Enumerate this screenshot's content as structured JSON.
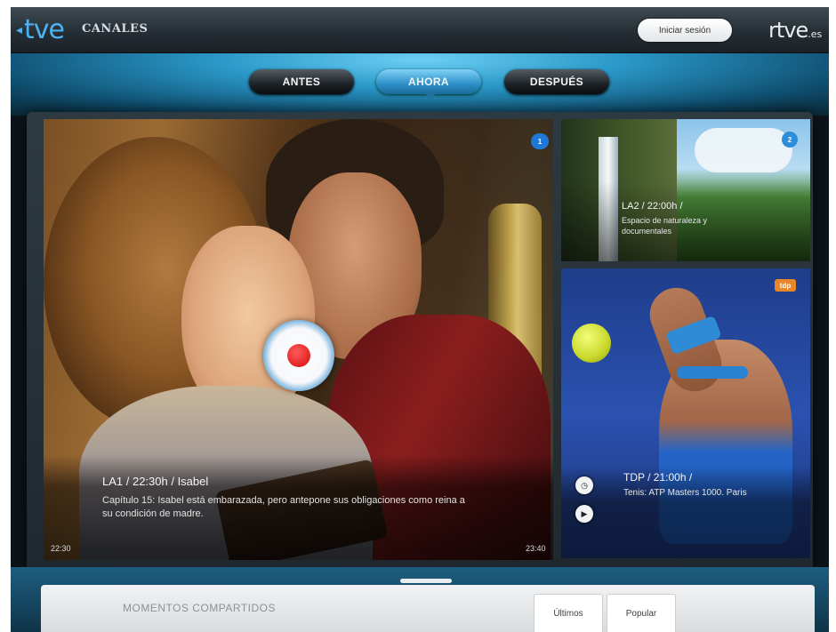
{
  "header": {
    "logo_text": "tve",
    "section_title": "CANALES",
    "login_label": "Iniciar sesión",
    "brand": "rtve",
    "brand_suffix": ".es"
  },
  "schedule_tabs": [
    {
      "label": "ANTES",
      "active": false
    },
    {
      "label": "AHORA",
      "active": true
    },
    {
      "label": "DESPUÉS",
      "active": false
    }
  ],
  "main_program": {
    "channel_badge": "1",
    "title": "LA1 / 22:30h / Isabel",
    "description": "Capítulo 15: Isabel está embarazada, pero antepone sus obligaciones como reina a su condición de madre.",
    "start_time": "22:30",
    "end_time": "23:40"
  },
  "side_programs": [
    {
      "channel_badge": "2",
      "title": "LA2 / 22:00h /",
      "description": "Espacio de naturaleza y documentales"
    },
    {
      "channel_badge": "tdp",
      "title": "TDP / 21:00h /",
      "description": "Tenis: ATP Masters 1000. Paris"
    }
  ],
  "moments_panel": {
    "title": "MOMENTOS COMPARTIDOS",
    "tabs": [
      "Últimos",
      "Popular"
    ]
  },
  "colors": {
    "accent": "#2c8fc6",
    "record": "#d40b0b"
  }
}
